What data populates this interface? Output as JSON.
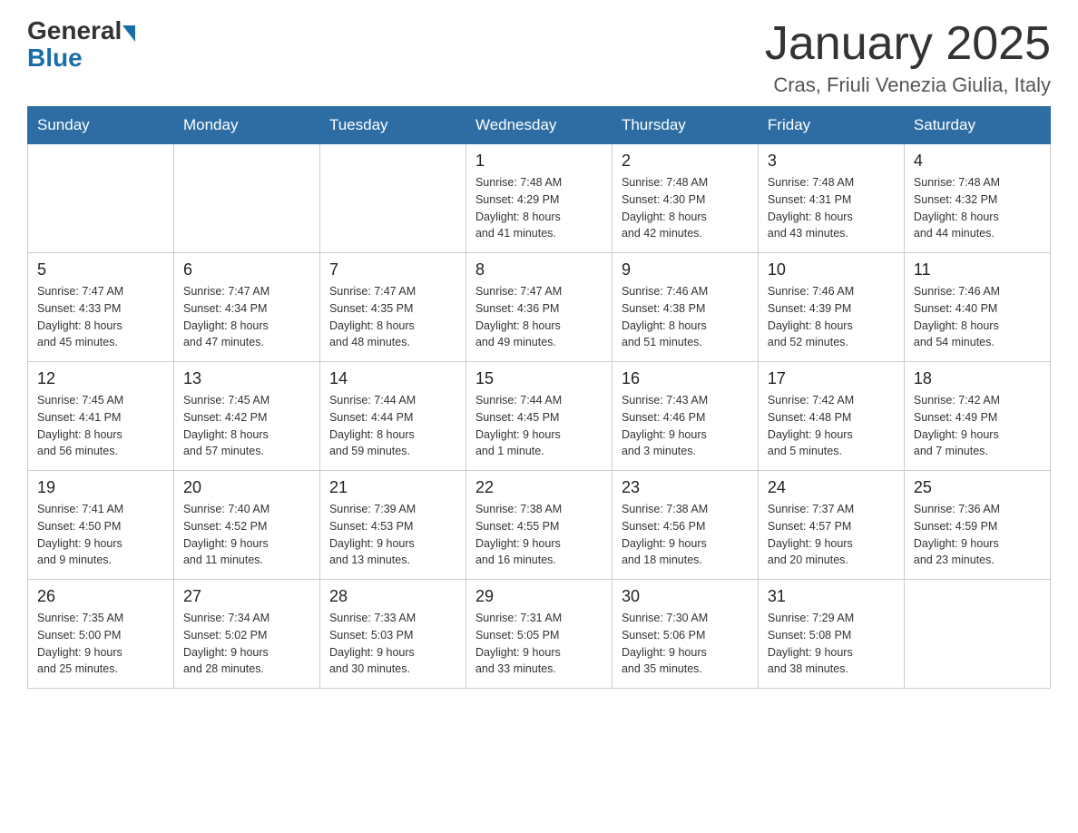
{
  "header": {
    "logo_general": "General",
    "logo_blue": "Blue",
    "title": "January 2025",
    "subtitle": "Cras, Friuli Venezia Giulia, Italy"
  },
  "days_of_week": [
    "Sunday",
    "Monday",
    "Tuesday",
    "Wednesday",
    "Thursday",
    "Friday",
    "Saturday"
  ],
  "weeks": [
    [
      {
        "day": "",
        "info": ""
      },
      {
        "day": "",
        "info": ""
      },
      {
        "day": "",
        "info": ""
      },
      {
        "day": "1",
        "info": "Sunrise: 7:48 AM\nSunset: 4:29 PM\nDaylight: 8 hours\nand 41 minutes."
      },
      {
        "day": "2",
        "info": "Sunrise: 7:48 AM\nSunset: 4:30 PM\nDaylight: 8 hours\nand 42 minutes."
      },
      {
        "day": "3",
        "info": "Sunrise: 7:48 AM\nSunset: 4:31 PM\nDaylight: 8 hours\nand 43 minutes."
      },
      {
        "day": "4",
        "info": "Sunrise: 7:48 AM\nSunset: 4:32 PM\nDaylight: 8 hours\nand 44 minutes."
      }
    ],
    [
      {
        "day": "5",
        "info": "Sunrise: 7:47 AM\nSunset: 4:33 PM\nDaylight: 8 hours\nand 45 minutes."
      },
      {
        "day": "6",
        "info": "Sunrise: 7:47 AM\nSunset: 4:34 PM\nDaylight: 8 hours\nand 47 minutes."
      },
      {
        "day": "7",
        "info": "Sunrise: 7:47 AM\nSunset: 4:35 PM\nDaylight: 8 hours\nand 48 minutes."
      },
      {
        "day": "8",
        "info": "Sunrise: 7:47 AM\nSunset: 4:36 PM\nDaylight: 8 hours\nand 49 minutes."
      },
      {
        "day": "9",
        "info": "Sunrise: 7:46 AM\nSunset: 4:38 PM\nDaylight: 8 hours\nand 51 minutes."
      },
      {
        "day": "10",
        "info": "Sunrise: 7:46 AM\nSunset: 4:39 PM\nDaylight: 8 hours\nand 52 minutes."
      },
      {
        "day": "11",
        "info": "Sunrise: 7:46 AM\nSunset: 4:40 PM\nDaylight: 8 hours\nand 54 minutes."
      }
    ],
    [
      {
        "day": "12",
        "info": "Sunrise: 7:45 AM\nSunset: 4:41 PM\nDaylight: 8 hours\nand 56 minutes."
      },
      {
        "day": "13",
        "info": "Sunrise: 7:45 AM\nSunset: 4:42 PM\nDaylight: 8 hours\nand 57 minutes."
      },
      {
        "day": "14",
        "info": "Sunrise: 7:44 AM\nSunset: 4:44 PM\nDaylight: 8 hours\nand 59 minutes."
      },
      {
        "day": "15",
        "info": "Sunrise: 7:44 AM\nSunset: 4:45 PM\nDaylight: 9 hours\nand 1 minute."
      },
      {
        "day": "16",
        "info": "Sunrise: 7:43 AM\nSunset: 4:46 PM\nDaylight: 9 hours\nand 3 minutes."
      },
      {
        "day": "17",
        "info": "Sunrise: 7:42 AM\nSunset: 4:48 PM\nDaylight: 9 hours\nand 5 minutes."
      },
      {
        "day": "18",
        "info": "Sunrise: 7:42 AM\nSunset: 4:49 PM\nDaylight: 9 hours\nand 7 minutes."
      }
    ],
    [
      {
        "day": "19",
        "info": "Sunrise: 7:41 AM\nSunset: 4:50 PM\nDaylight: 9 hours\nand 9 minutes."
      },
      {
        "day": "20",
        "info": "Sunrise: 7:40 AM\nSunset: 4:52 PM\nDaylight: 9 hours\nand 11 minutes."
      },
      {
        "day": "21",
        "info": "Sunrise: 7:39 AM\nSunset: 4:53 PM\nDaylight: 9 hours\nand 13 minutes."
      },
      {
        "day": "22",
        "info": "Sunrise: 7:38 AM\nSunset: 4:55 PM\nDaylight: 9 hours\nand 16 minutes."
      },
      {
        "day": "23",
        "info": "Sunrise: 7:38 AM\nSunset: 4:56 PM\nDaylight: 9 hours\nand 18 minutes."
      },
      {
        "day": "24",
        "info": "Sunrise: 7:37 AM\nSunset: 4:57 PM\nDaylight: 9 hours\nand 20 minutes."
      },
      {
        "day": "25",
        "info": "Sunrise: 7:36 AM\nSunset: 4:59 PM\nDaylight: 9 hours\nand 23 minutes."
      }
    ],
    [
      {
        "day": "26",
        "info": "Sunrise: 7:35 AM\nSunset: 5:00 PM\nDaylight: 9 hours\nand 25 minutes."
      },
      {
        "day": "27",
        "info": "Sunrise: 7:34 AM\nSunset: 5:02 PM\nDaylight: 9 hours\nand 28 minutes."
      },
      {
        "day": "28",
        "info": "Sunrise: 7:33 AM\nSunset: 5:03 PM\nDaylight: 9 hours\nand 30 minutes."
      },
      {
        "day": "29",
        "info": "Sunrise: 7:31 AM\nSunset: 5:05 PM\nDaylight: 9 hours\nand 33 minutes."
      },
      {
        "day": "30",
        "info": "Sunrise: 7:30 AM\nSunset: 5:06 PM\nDaylight: 9 hours\nand 35 minutes."
      },
      {
        "day": "31",
        "info": "Sunrise: 7:29 AM\nSunset: 5:08 PM\nDaylight: 9 hours\nand 38 minutes."
      },
      {
        "day": "",
        "info": ""
      }
    ]
  ]
}
